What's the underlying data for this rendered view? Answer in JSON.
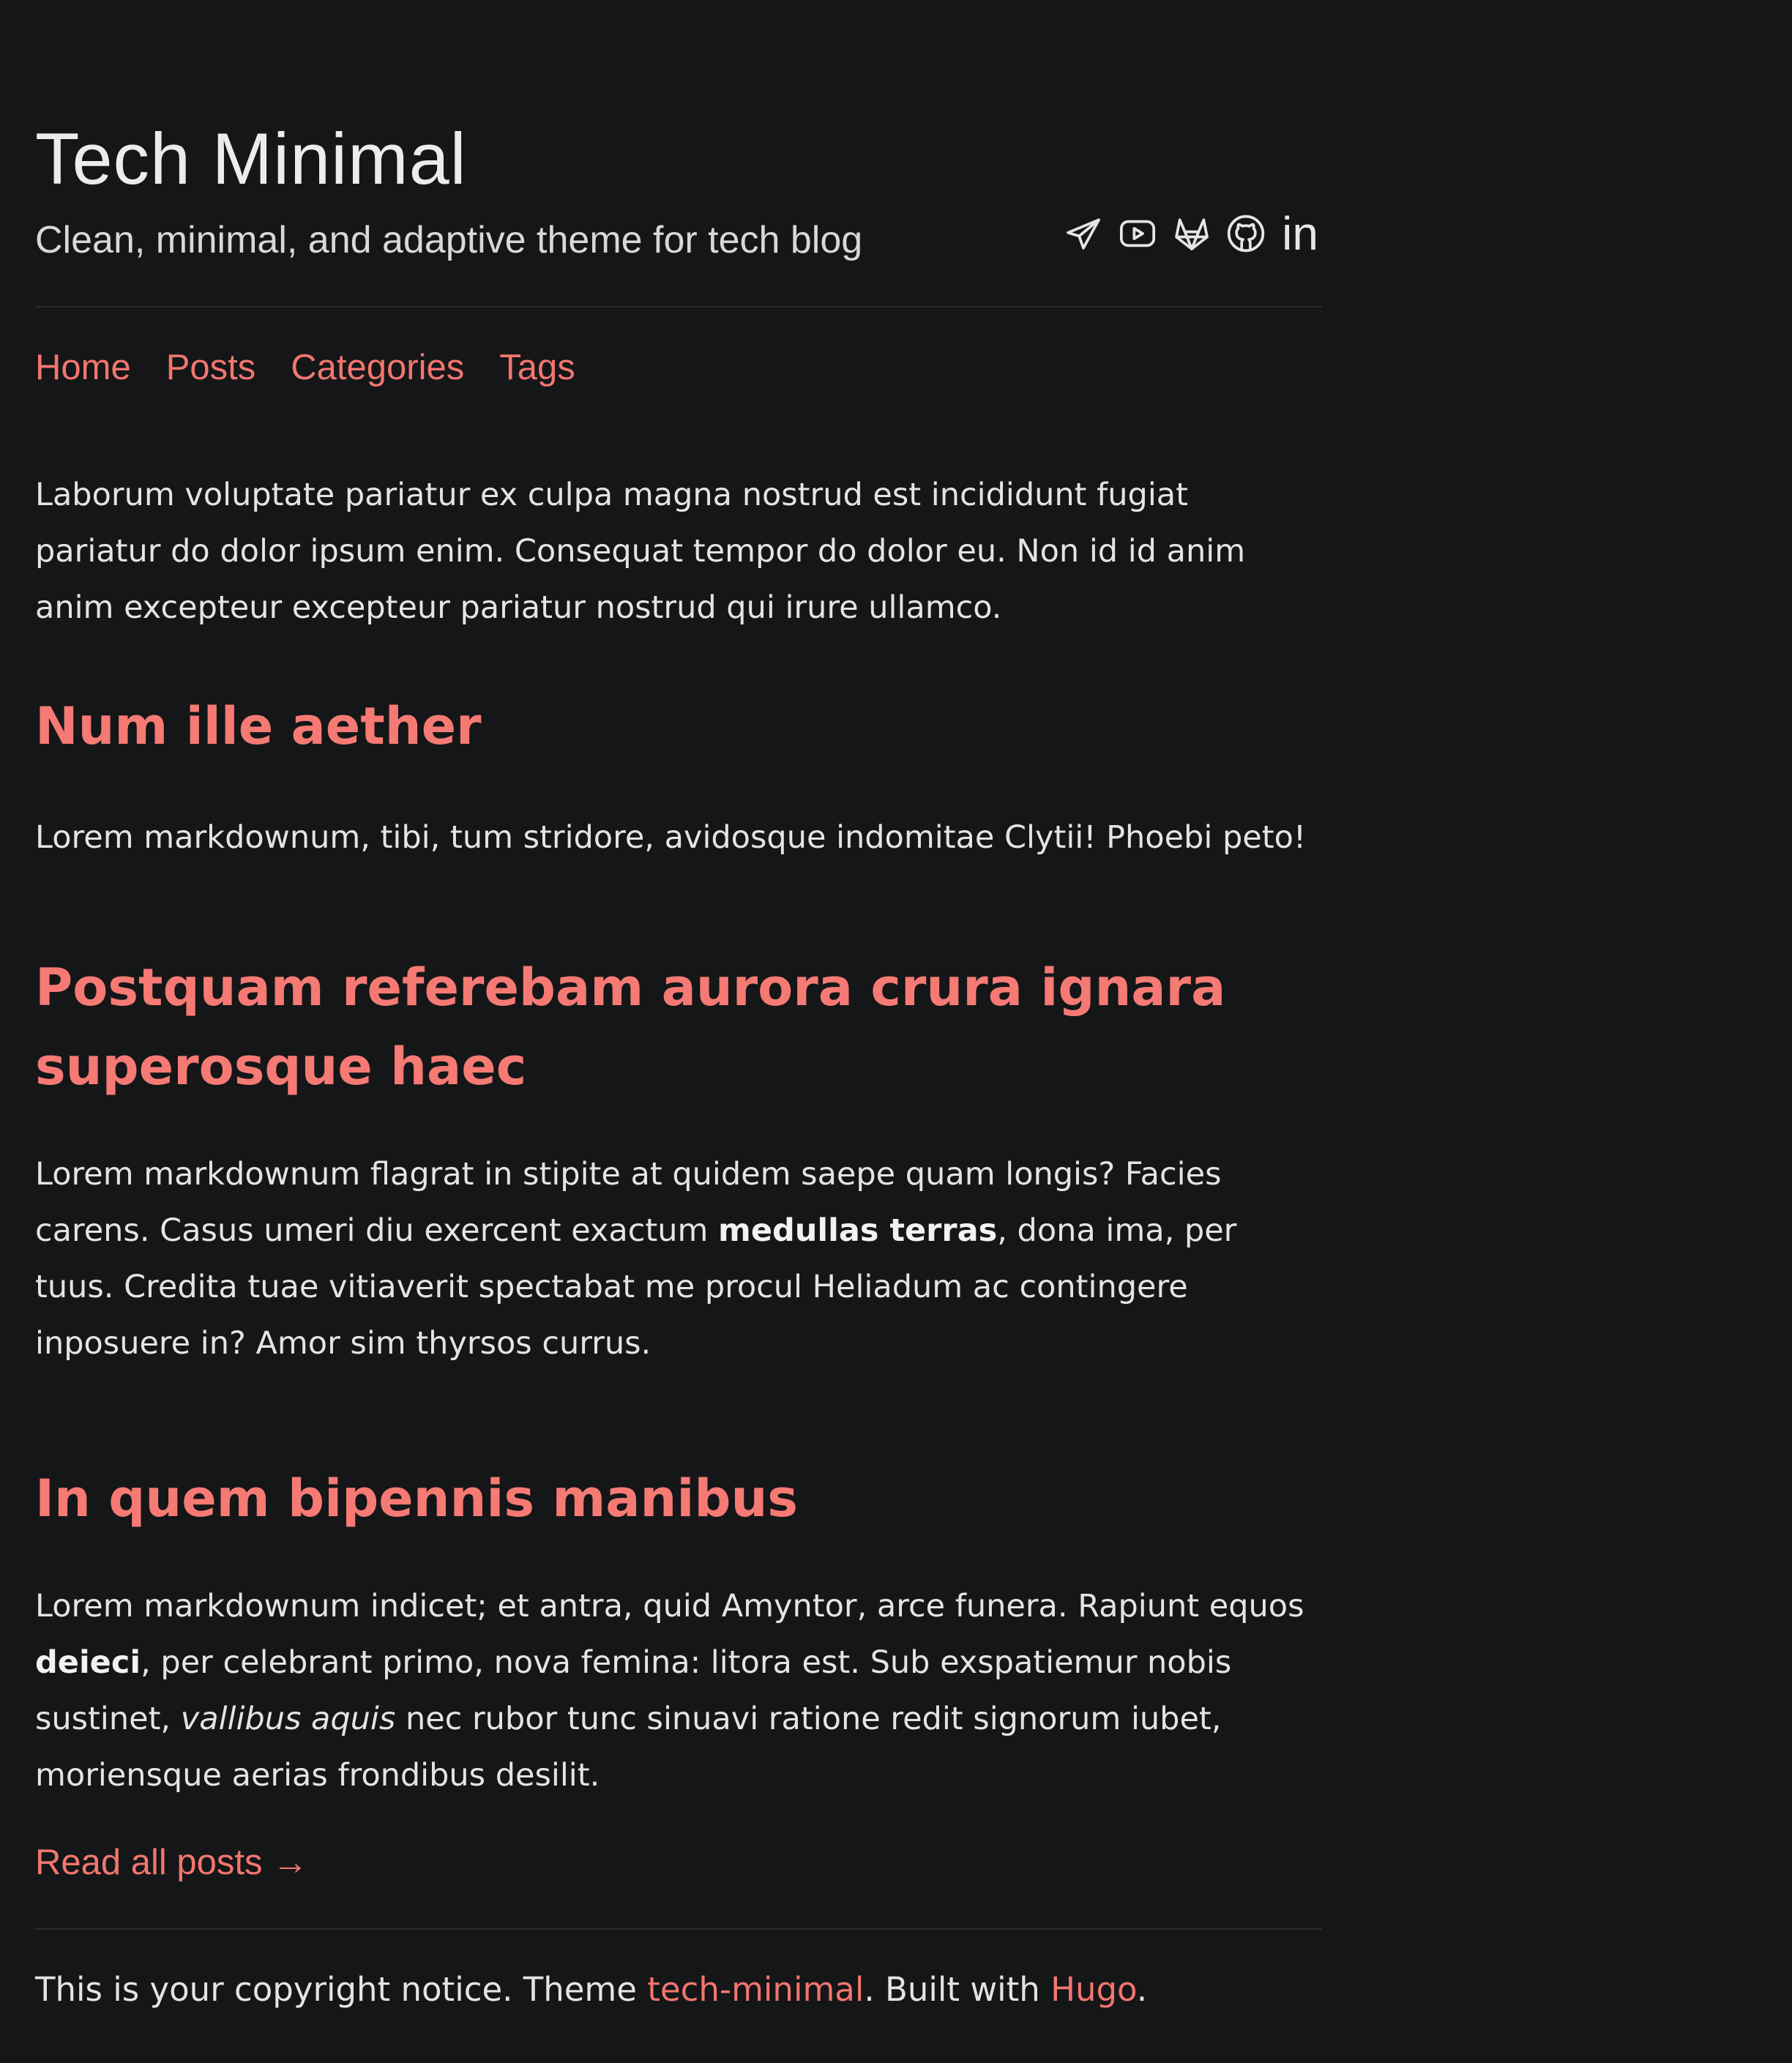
{
  "site": {
    "title": "Tech Minimal",
    "subtitle": "Clean, minimal, and adaptive theme for tech blog"
  },
  "social": [
    {
      "icon": "telegram-icon"
    },
    {
      "icon": "youtube-icon"
    },
    {
      "icon": "gitlab-icon"
    },
    {
      "icon": "github-icon"
    },
    {
      "icon": "linkedin-icon",
      "label": "in"
    }
  ],
  "nav": {
    "home": "Home",
    "posts": "Posts",
    "categories": "Categories",
    "tags": "Tags"
  },
  "intro": "Laborum voluptate pariatur ex culpa magna nostrud est incididunt fugiat pariatur do dolor ipsum enim. Consequat tempor do dolor eu. Non id id anim anim excepteur excepteur pariatur nostrud qui irure ullamco.",
  "sections": [
    {
      "heading": "Num ille aether",
      "body": "Lorem markdownum, tibi, tum stridore, avidosque indomitae Clytii! Phoebi peto!"
    },
    {
      "heading": "Postquam referebam aurora crura ignara superosque haec",
      "body_pre": "Lorem markdownum flagrat in stipite at quidem saepe quam longis? Facies carens. Casus umeri diu exercent exactum ",
      "body_bold": "medullas terras",
      "body_post": ", dona ima, per tuus. Credita tuae vitiaverit spectabat me procul Heliadum ac contingere inposuere in? Amor sim thyrsos currus."
    },
    {
      "heading": "In quem bipennis manibus",
      "body_pre": "Lorem markdownum indicet; et antra, quid Amyntor, arce funera. Rapiunt equos ",
      "body_bold": "deieci",
      "body_mid": ", per celebrant primo, nova femina: litora est. Sub exspatiemur nobis sustinet, ",
      "body_italic": "vallibus aquis",
      "body_post": " nec rubor tunc sinuavi ratione redit signorum iubet, moriensque aerias frondibus desilit."
    }
  ],
  "read_all": "Read all posts →",
  "footer": {
    "pre": "This is your copyright notice. Theme ",
    "theme_link": "tech-minimal",
    "mid": ". Built with ",
    "hugo_link": "Hugo",
    "post": "."
  },
  "colors": {
    "background": "#151618",
    "accent": "#f2766e",
    "text": "#e4e4e4"
  }
}
